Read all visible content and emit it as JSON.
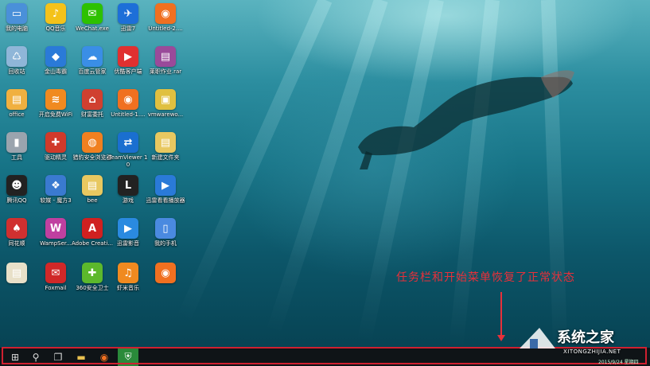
{
  "desktop": {
    "icons": [
      {
        "label": "我的电脑",
        "color": "#4a90d9",
        "glyph": "▭"
      },
      {
        "label": "QQ音乐",
        "color": "#f4c21a",
        "glyph": "♪"
      },
      {
        "label": "WeChat.exe",
        "color": "#2dc100",
        "glyph": "✉"
      },
      {
        "label": "迅雷7",
        "color": "#1d6fd8",
        "glyph": "✈"
      },
      {
        "label": "Untitled-2....",
        "color": "#f07020",
        "glyph": "◉"
      },
      {
        "label": "回收站",
        "color": "#8fb6d8",
        "glyph": "♺"
      },
      {
        "label": "金山毒霸",
        "color": "#2a7ad8",
        "glyph": "◆"
      },
      {
        "label": "百度云管家",
        "color": "#3a8ee6",
        "glyph": "☁"
      },
      {
        "label": "优酷客户端",
        "color": "#e03030",
        "glyph": "▶"
      },
      {
        "label": "莱职作业.rar",
        "color": "#9a4a9a",
        "glyph": "▤"
      },
      {
        "label": "office",
        "color": "#f0b040",
        "glyph": "▤"
      },
      {
        "label": "开启免费WiFi",
        "color": "#f08a20",
        "glyph": "≋"
      },
      {
        "label": "财富委托",
        "color": "#d04030",
        "glyph": "⌂"
      },
      {
        "label": "Untitled-1....",
        "color": "#f07020",
        "glyph": "◉"
      },
      {
        "label": "vmwarewo...",
        "color": "#e0c040",
        "glyph": "▣"
      },
      {
        "label": "工具",
        "color": "#9aa4ae",
        "glyph": "▮"
      },
      {
        "label": "驱动精灵",
        "color": "#d03a2a",
        "glyph": "✚"
      },
      {
        "label": "猎豹安全浏览器",
        "color": "#f08020",
        "glyph": "◍"
      },
      {
        "label": "TeamViewer 10",
        "color": "#1a6fd0",
        "glyph": "⇄"
      },
      {
        "label": "新建文件夹",
        "color": "#e8c860",
        "glyph": "▤"
      },
      {
        "label": "腾讯QQ",
        "color": "#222222",
        "glyph": "☻"
      },
      {
        "label": "软媒 - 魔方3",
        "color": "#3a7ad0",
        "glyph": "❖"
      },
      {
        "label": "bee",
        "color": "#e8c860",
        "glyph": "▤"
      },
      {
        "label": "游戏",
        "color": "#222222",
        "glyph": "L"
      },
      {
        "label": "迅雷看看播放器",
        "color": "#2a7ad8",
        "glyph": "▶"
      },
      {
        "label": "同花顺",
        "color": "#d03030",
        "glyph": "♠"
      },
      {
        "label": "WampSer...",
        "color": "#c040a0",
        "glyph": "W"
      },
      {
        "label": "Adobe Creati...",
        "color": "#d02020",
        "glyph": "A"
      },
      {
        "label": "迅雷影音",
        "color": "#2a8ae0",
        "glyph": "▶"
      },
      {
        "label": "我的手机",
        "color": "#4a8ae0",
        "glyph": "▯"
      },
      {
        "label": "",
        "color": "#e8e0c8",
        "glyph": "▤"
      },
      {
        "label": "Foxmail",
        "color": "#d02828",
        "glyph": "✉"
      },
      {
        "label": "360安全卫士",
        "color": "#5cb82c",
        "glyph": "✚"
      },
      {
        "label": "虾米音乐",
        "color": "#f08a20",
        "glyph": "♫"
      },
      {
        "label": "",
        "color": "#f07020",
        "glyph": "◉"
      }
    ]
  },
  "annotation": {
    "text": "任务栏和开始菜单恢复了正常状态"
  },
  "taskbar": {
    "items": [
      {
        "name": "start-button",
        "glyph": "⊞"
      },
      {
        "name": "search-icon",
        "glyph": "⚲"
      },
      {
        "name": "task-view-icon",
        "glyph": "❐"
      },
      {
        "name": "file-explorer-icon",
        "glyph": "▬"
      },
      {
        "name": "app-icon",
        "glyph": "◉"
      },
      {
        "name": "shield-icon",
        "glyph": "⛨"
      }
    ],
    "clock": "2015/9/24 星期四"
  },
  "watermark": {
    "title": "系统之家",
    "subtitle": "XITONGZHIJIA.NET"
  },
  "colors": {
    "annotation": "#e8303a",
    "taskbar_outline": "#d02030"
  }
}
